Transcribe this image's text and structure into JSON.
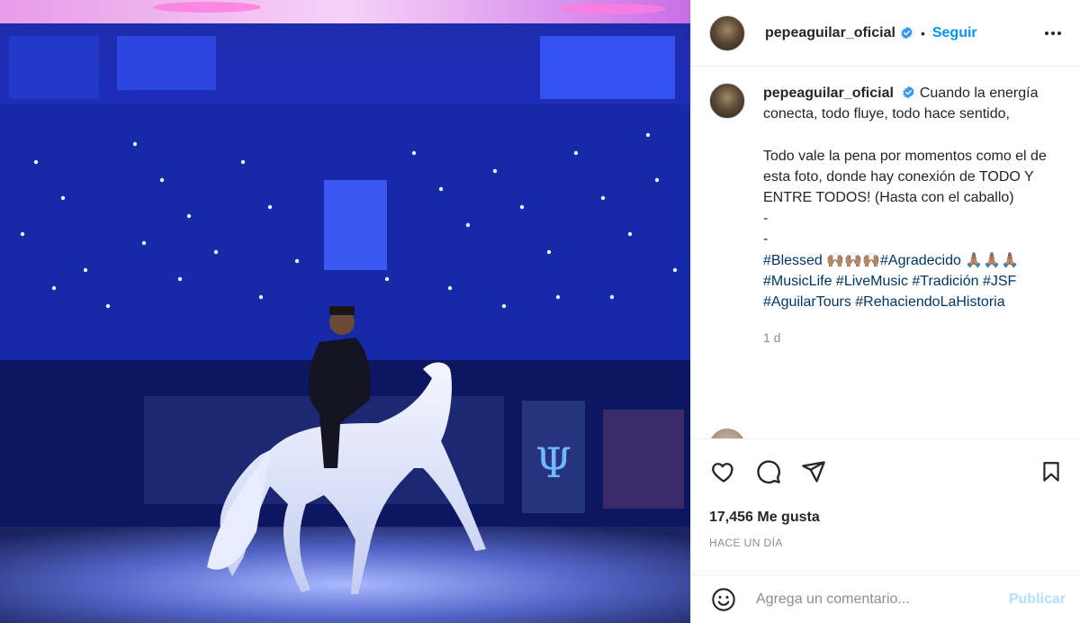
{
  "post": {
    "username": "pepeaguilar_oficial",
    "follow_label": "Seguir",
    "separator": "•",
    "caption_text": "Cuando la energía conecta, todo fluye, todo hace sentido,\n\nTodo vale la pena por momentos como el de esta foto, donde hay conexión de TODO Y ENTRE TODOS! (Hasta con el caballo)\n-\n-",
    "hashtags": "#Blessed 🙌🏽🙌🏽🙌🏽#Agradecido 🙏🏽🙏🏽🙏🏽\n#MusicLife #LiveMusic #Tradición #JSF #AguilarTours #RehaciendoLaHistoria",
    "time_short": "1 d",
    "likes": "17,456 Me gusta",
    "time_long": "HACE UN DÍA"
  },
  "comment_box": {
    "placeholder": "Agrega un comentario...",
    "publish_label": "Publicar"
  },
  "colors": {
    "link_blue": "#0095f6",
    "hashtag_blue": "#00376b",
    "publish_disabled": "#b2dffc",
    "verified": "#3897f0"
  },
  "icons": {
    "more": "more-horizontal-icon",
    "like": "heart-icon",
    "comment": "comment-bubble-icon",
    "share": "paper-plane-icon",
    "save": "bookmark-icon",
    "emoji": "smiley-icon",
    "verified": "verified-badge-icon"
  }
}
